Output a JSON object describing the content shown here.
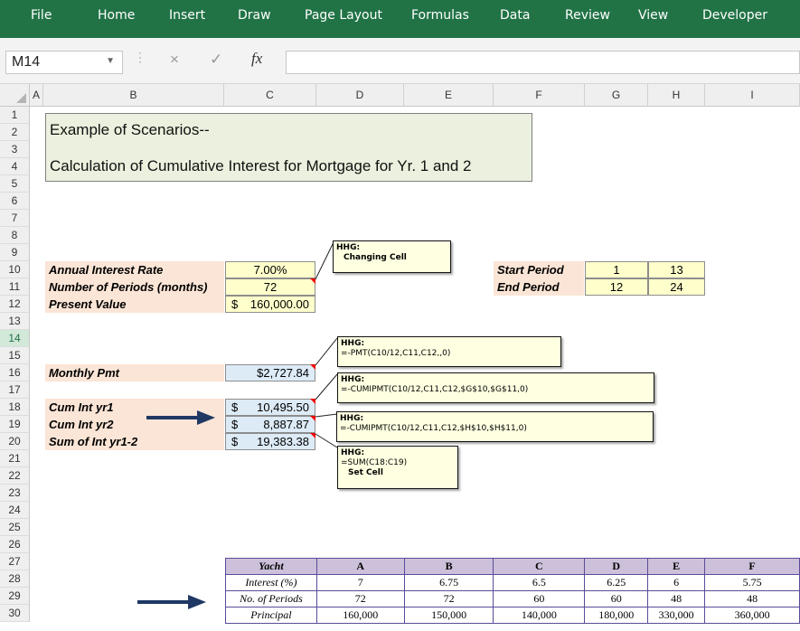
{
  "ribbon": {
    "tabs": [
      "File",
      "Home",
      "Insert",
      "Draw",
      "Page Layout",
      "Formulas",
      "Data",
      "Review",
      "View",
      "Developer"
    ]
  },
  "formula_bar": {
    "name_box": "M14",
    "cancel_icon": "×",
    "enter_icon": "✓",
    "fx_label": "fx",
    "formula": ""
  },
  "columns": [
    "A",
    "B",
    "C",
    "D",
    "E",
    "F",
    "G",
    "H",
    "I"
  ],
  "rows": [
    "1",
    "2",
    "3",
    "4",
    "5",
    "6",
    "7",
    "8",
    "9",
    "10",
    "11",
    "12",
    "13",
    "14",
    "15",
    "16",
    "17",
    "18",
    "19",
    "20",
    "21",
    "22",
    "23",
    "24",
    "25",
    "26",
    "27",
    "28",
    "29",
    "30"
  ],
  "selected_row": "14",
  "title": {
    "line1": "Example of Scenarios--",
    "line2": "Calculation of Cumulative Interest for Mortgage for Yr. 1 and 2"
  },
  "inputs": {
    "rate_label": "Annual Interest Rate",
    "rate_value": "7.00%",
    "periods_label": "Number of Periods (months)",
    "periods_value": "72",
    "pv_label": "Present Value",
    "pv_currency": "$",
    "pv_value": "160,000.00"
  },
  "periods": {
    "start_label": "Start Period",
    "end_label": "End Period",
    "start_g": "1",
    "start_h": "13",
    "end_g": "12",
    "end_h": "24"
  },
  "results": {
    "pmt_label": "Monthly Pmt",
    "pmt_value": "$2,727.84",
    "cum1_label": "Cum Int yr1",
    "cum1_value": "10,495.50",
    "cum2_label": "Cum Int yr2",
    "cum2_value": "8,887.87",
    "sum_label": "Sum of Int yr1-2",
    "sum_value": "19,383.38",
    "currency": "$"
  },
  "comments": {
    "changing": {
      "author": "HHG:",
      "text": "Changing Cell"
    },
    "pmt": {
      "author": "HHG:",
      "text": "=-PMT(C10/12,C11,C12,,0)"
    },
    "cum1": {
      "author": "HHG:",
      "text": "=-CUMIPMT(C10/12,C11,C12,$G$10,$G$11,0)"
    },
    "cum2": {
      "author": "HHG:",
      "text": "=-CUMIPMT(C10/12,C11,C12,$H$10,$H$11,0)"
    },
    "sum": {
      "author": "HHG:",
      "text": "=SUM(C18:C19)",
      "text2": "Set Cell"
    }
  },
  "yacht_table": {
    "header": [
      "Yacht",
      "A",
      "B",
      "C",
      "D",
      "E",
      "F"
    ],
    "rows": [
      [
        "Interest (%)",
        "7",
        "6.75",
        "6.5",
        "6.25",
        "6",
        "5.75"
      ],
      [
        "No. of Periods",
        "72",
        "72",
        "60",
        "60",
        "48",
        "48"
      ],
      [
        "Principal",
        "160,000",
        "150,000",
        "140,000",
        "180,000",
        "330,000",
        "360,000"
      ]
    ]
  },
  "colors": {
    "ribbon": "#217346",
    "label_fill": "#fbe5d6",
    "input_fill": "#ffffcc",
    "result_fill": "#ddebf7",
    "title_fill": "#ebf1de",
    "table_header_fill": "#ccc0da",
    "arrow": "#1f3864"
  }
}
